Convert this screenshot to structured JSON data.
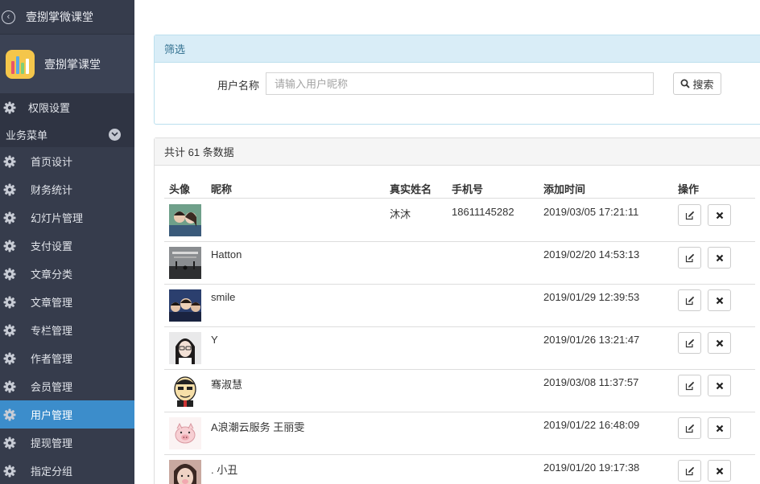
{
  "sidebar": {
    "app_title": "壹捌掌微课堂",
    "brand_name": "壹捌掌课堂",
    "top_item": "权限设置",
    "section_label": "业务菜单",
    "items": [
      "首页设计",
      "财务统计",
      "幻灯片管理",
      "支付设置",
      "文章分类",
      "文章管理",
      "专栏管理",
      "作者管理",
      "会员管理",
      "用户管理",
      "提现管理",
      "指定分组"
    ],
    "active_item": "用户管理",
    "active_color": "#3c8dcb"
  },
  "filter": {
    "title": "筛选",
    "label": "用户名称",
    "placeholder": "请输入用户昵称",
    "value": "",
    "search_label": "搜索"
  },
  "list": {
    "summary": "共计 61 条数据",
    "columns": [
      "头像",
      "昵称",
      "真实姓名",
      "手机号",
      "添加时间",
      "操作"
    ],
    "rows": [
      {
        "nickname": "",
        "real_name": "沐沐",
        "phone": "18611145282",
        "added": "2019/03/05 17:21:11",
        "avatar_icon": "couple-photo"
      },
      {
        "nickname": "Hatton",
        "real_name": "",
        "phone": "",
        "added": "2019/02/20 14:53:13",
        "avatar_icon": "hall-photo"
      },
      {
        "nickname": "smile",
        "real_name": "",
        "phone": "",
        "added": "2019/01/29 12:39:53",
        "avatar_icon": "group-photo"
      },
      {
        "nickname": "Y",
        "real_name": "",
        "phone": "",
        "added": "2019/01/26 13:21:47",
        "avatar_icon": "girl-photo"
      },
      {
        "nickname": "骞淑慧",
        "real_name": "",
        "phone": "",
        "added": "2019/03/08 11:37:57",
        "avatar_icon": "cartoon-man"
      },
      {
        "nickname": "A浪潮云服务 王丽雯",
        "real_name": "",
        "phone": "",
        "added": "2019/01/22 16:48:09",
        "avatar_icon": "cartoon-pig"
      },
      {
        "nickname": ". 小丑",
        "real_name": "",
        "phone": "",
        "added": "2019/01/20 19:17:38",
        "avatar_icon": "girl-pig-filter"
      }
    ]
  }
}
